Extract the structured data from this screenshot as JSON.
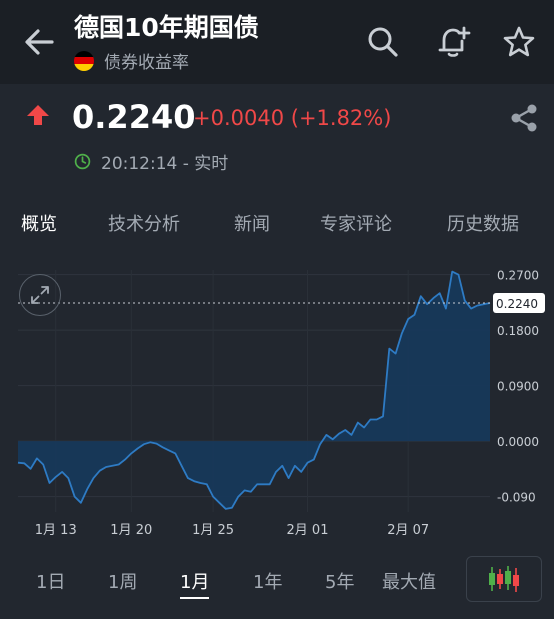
{
  "header": {
    "title": "德国10年期国债",
    "subtitle": "债券收益率",
    "flag_colors": [
      "#000000",
      "#dd0000",
      "#ffce00"
    ]
  },
  "icons": {
    "back": "arrow-left-icon",
    "search": "search-icon",
    "alert": "bell-plus-icon",
    "favorite": "star-icon",
    "share": "share-icon",
    "expand": "expand-icon",
    "chart_type": "candlestick-icon"
  },
  "quote": {
    "price": "0.2240",
    "change": "+0.0040 (+1.82%)",
    "direction": "up",
    "time": "20:12:14 - 实时"
  },
  "tabs": [
    {
      "label": "概览",
      "active": true
    },
    {
      "label": "技术分析",
      "active": false
    },
    {
      "label": "新闻",
      "active": false
    },
    {
      "label": "专家评论",
      "active": false
    },
    {
      "label": "历史数据",
      "active": false
    }
  ],
  "ranges": [
    {
      "label": "1日",
      "active": false
    },
    {
      "label": "1周",
      "active": false
    },
    {
      "label": "1月",
      "active": true
    },
    {
      "label": "1年",
      "active": false
    },
    {
      "label": "5年",
      "active": false
    },
    {
      "label": "最大值",
      "active": false
    }
  ],
  "colors": {
    "up": "#f04848",
    "line": "#2e7bc4",
    "fill": "#17385a",
    "clock": "#4fb04a"
  },
  "chart_data": {
    "type": "area",
    "x_ticks": [
      "1月 13",
      "1月 20",
      "1月 25",
      "2月 01",
      "2月 07"
    ],
    "y_ticks": [
      "0.2700",
      "0.1800",
      "0.0900",
      "0.0000",
      "-0.090"
    ],
    "y_tick_values": [
      0.27,
      0.18,
      0.09,
      0.0,
      -0.09
    ],
    "last_label": "0.2240",
    "last_value": 0.224,
    "ylim": [
      -0.115,
      0.31
    ],
    "values": [
      -0.035,
      -0.036,
      -0.045,
      -0.028,
      -0.038,
      -0.068,
      -0.058,
      -0.05,
      -0.06,
      -0.09,
      -0.1,
      -0.078,
      -0.06,
      -0.048,
      -0.042,
      -0.04,
      -0.038,
      -0.03,
      -0.02,
      -0.012,
      -0.005,
      -0.002,
      -0.004,
      -0.01,
      -0.015,
      -0.02,
      -0.04,
      -0.06,
      -0.065,
      -0.068,
      -0.07,
      -0.09,
      -0.1,
      -0.11,
      -0.108,
      -0.09,
      -0.08,
      -0.082,
      -0.07,
      -0.07,
      -0.07,
      -0.05,
      -0.04,
      -0.06,
      -0.04,
      -0.05,
      -0.035,
      -0.03,
      -0.005,
      0.01,
      0.003,
      0.012,
      0.018,
      0.01,
      0.03,
      0.022,
      0.035,
      0.035,
      0.04,
      0.15,
      0.142,
      0.175,
      0.198,
      0.205,
      0.235,
      0.222,
      0.232,
      0.24,
      0.215,
      0.275,
      0.27,
      0.228,
      0.215,
      0.22,
      0.222,
      0.224
    ],
    "grid": true
  }
}
